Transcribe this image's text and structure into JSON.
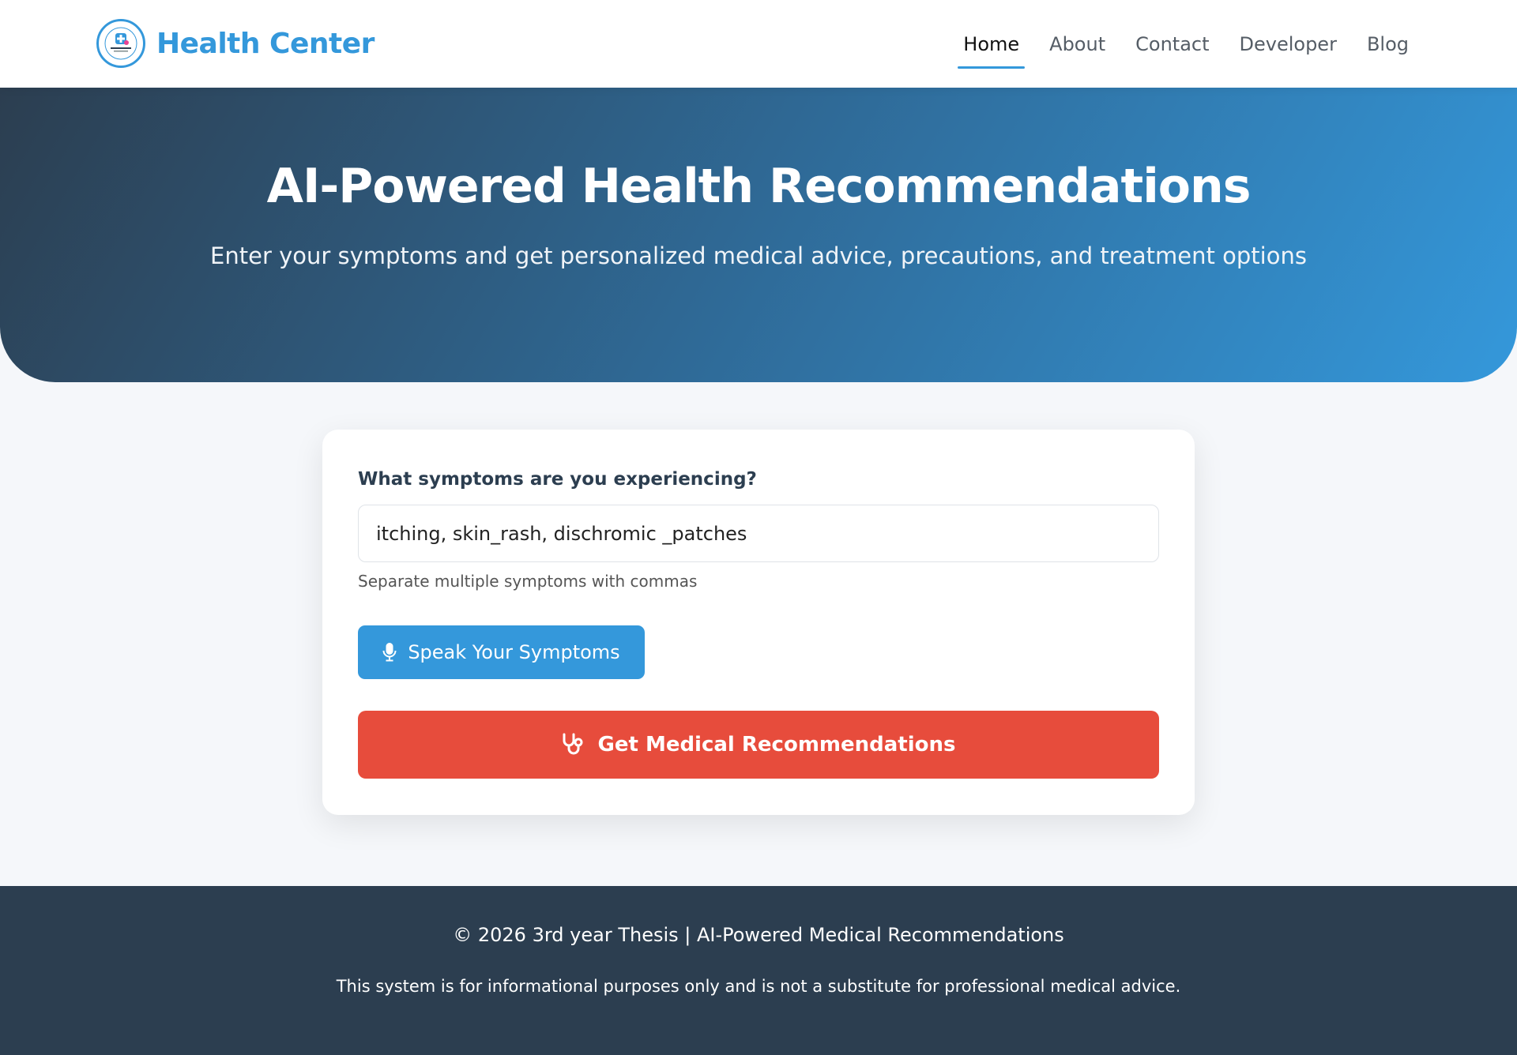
{
  "brand": {
    "name": "Health Center",
    "logo_icon": "health-center-logo-icon",
    "accent_color": "#3498db"
  },
  "nav": {
    "items": [
      {
        "label": "Home",
        "active": true
      },
      {
        "label": "About",
        "active": false
      },
      {
        "label": "Contact",
        "active": false
      },
      {
        "label": "Developer",
        "active": false
      },
      {
        "label": "Blog",
        "active": false
      }
    ]
  },
  "hero": {
    "title": "AI-Powered Health Recommendations",
    "subtitle": "Enter your symptoms and get personalized medical advice, precautions, and treatment options",
    "gradient_start": "#2c3e50",
    "gradient_end": "#3498db"
  },
  "form": {
    "label": "What symptoms are you experiencing?",
    "input_value": "itching, skin_rash, dischromic _patches",
    "hint": "Separate multiple symptoms with commas",
    "speak_button": {
      "label": "Speak Your Symptoms",
      "icon": "microphone-icon",
      "color": "#3498db"
    },
    "submit_button": {
      "label": "Get Medical Recommendations",
      "icon": "stethoscope-icon",
      "color": "#e74c3c"
    }
  },
  "footer": {
    "copyright": "© 2026 3rd year Thesis | AI-Powered Medical Recommendations",
    "disclaimer": "This system is for informational purposes only and is not a substitute for professional medical advice.",
    "background": "#2c3e50"
  }
}
